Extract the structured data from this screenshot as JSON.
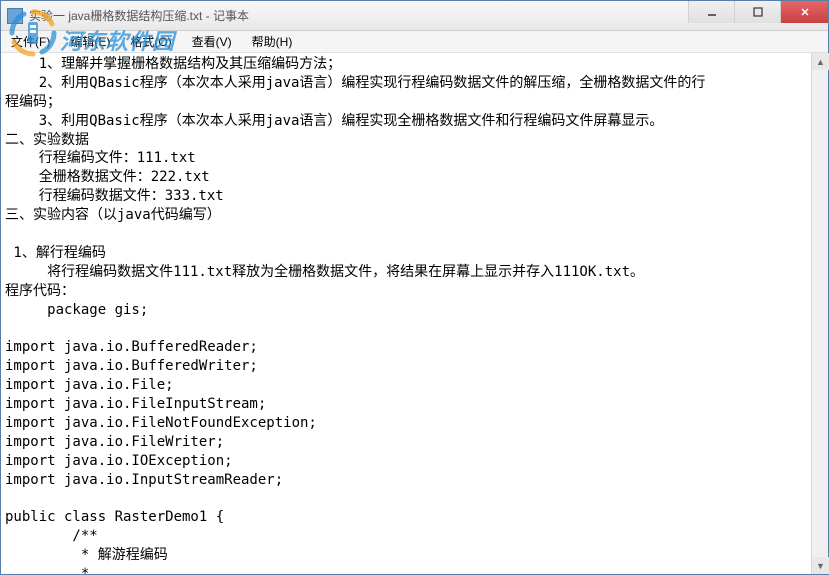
{
  "titlebar": {
    "title": "实验一 java栅格数据结构压缩.txt - 记事本"
  },
  "window_controls": {
    "min": "—",
    "max": "□",
    "close": "✕"
  },
  "menubar": {
    "file": "文件(F)",
    "edit": "编辑(E)",
    "format": "格式(O)",
    "view": "查看(V)",
    "help": "帮助(H)"
  },
  "content": "    1、理解并掌握栅格数据结构及其压缩编码方法；\n    2、利用QBasic程序（本次本人采用java语言）编程实现行程编码数据文件的解压缩，全栅格数据文件的行\n程编码；\n    3、利用QBasic程序（本次本人采用java语言）编程实现全栅格数据文件和行程编码文件屏幕显示。\n二、实验数据\n    行程编码文件：111.txt\n    全栅格数据文件：222.txt\n    行程编码数据文件：333.txt\n三、实验内容（以java代码编写）\n\n 1、解行程编码\n     将行程编码数据文件111.txt释放为全栅格数据文件，将结果在屏幕上显示并存入111OK.txt。\n程序代码：\n     package gis;\n\nimport java.io.BufferedReader;\nimport java.io.BufferedWriter;\nimport java.io.File;\nimport java.io.FileInputStream;\nimport java.io.FileNotFoundException;\nimport java.io.FileWriter;\nimport java.io.IOException;\nimport java.io.InputStreamReader;\n\npublic class RasterDemo1 {\n        /**\n         * 解游程编码\n         * \n         * @param args\n         * @author Houbin\n         */",
  "watermark": {
    "text": "河东软件园"
  }
}
